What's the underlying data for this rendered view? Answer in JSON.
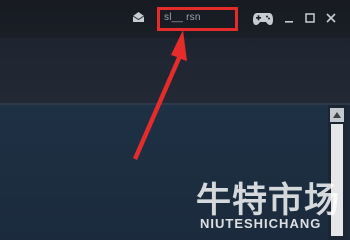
{
  "titlebar": {
    "mail_icon": "envelope-icon",
    "username": "sl__ rsn",
    "controller_icon": "gamepad-icon",
    "minimize_glyph": "_",
    "maximize_glyph": "☐",
    "close_glyph": "✕"
  },
  "annotation": {
    "highlight_color": "#e62b2b"
  },
  "scrollbar": {
    "up_arrow_glyph": "▲"
  },
  "watermark": {
    "chinese": "牛特市场",
    "english": "NIUTESHICHANG"
  },
  "colors": {
    "titlebar": "#171a21",
    "content": "#1b2b3d",
    "accent": "#e62b2b"
  }
}
